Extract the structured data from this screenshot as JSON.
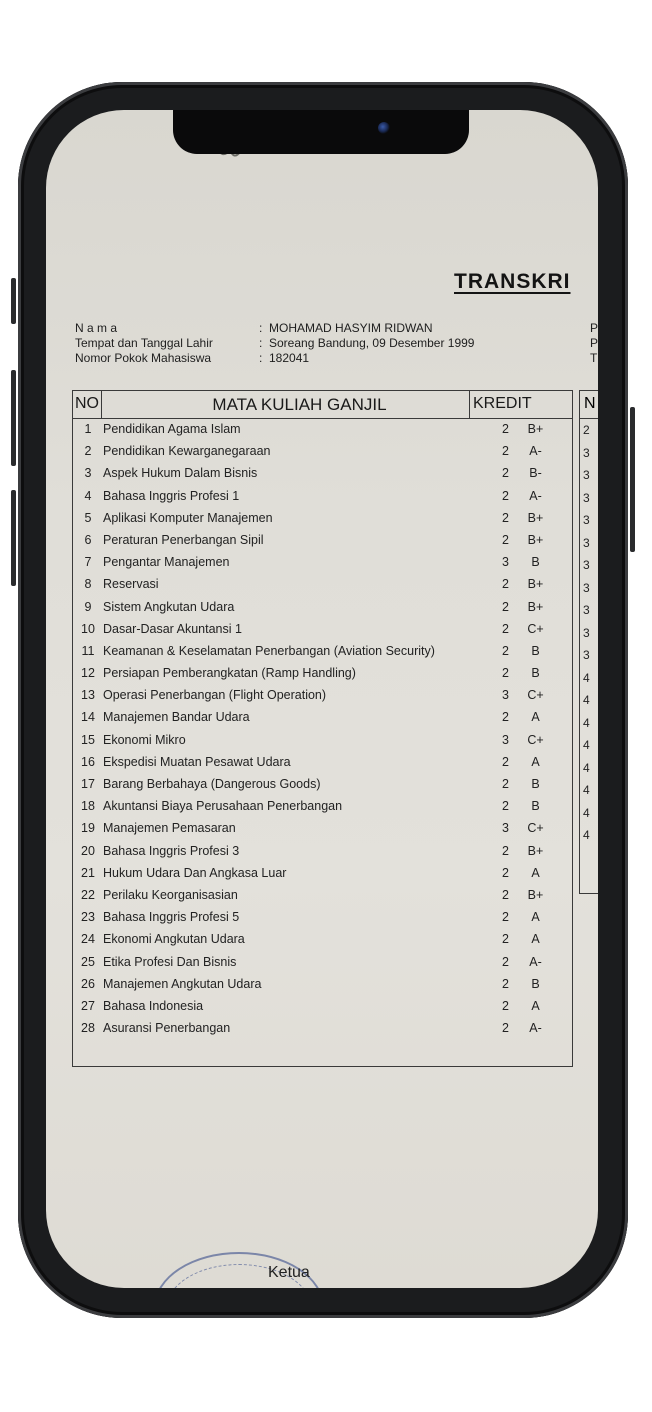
{
  "document": {
    "title": "TRANSKRI",
    "info": [
      {
        "label": "N a m a",
        "value": "MOHAMAD HASYIM RIDWAN"
      },
      {
        "label": "Tempat dan Tanggal Lahir",
        "value": "Soreang Bandung, 09 Desember 1999"
      },
      {
        "label": "Nomor Pokok Mahasiswa",
        "value": "182041"
      }
    ],
    "right_info": [
      "P",
      "P",
      "T"
    ],
    "table": {
      "headers": {
        "no": "NO",
        "course": "MATA KULIAH GANJIL",
        "credit": "KREDIT"
      },
      "rows": [
        {
          "no": "1",
          "course": "Pendidikan Agama Islam",
          "credit": "2",
          "grade": "B+"
        },
        {
          "no": "2",
          "course": "Pendidikan Kewarganegaraan",
          "credit": "2",
          "grade": "A-"
        },
        {
          "no": "3",
          "course": "Aspek Hukum Dalam Bisnis",
          "credit": "2",
          "grade": "B-"
        },
        {
          "no": "4",
          "course": "Bahasa Inggris Profesi 1",
          "credit": "2",
          "grade": "A-"
        },
        {
          "no": "5",
          "course": "Aplikasi Komputer Manajemen",
          "credit": "2",
          "grade": "B+"
        },
        {
          "no": "6",
          "course": "Peraturan Penerbangan Sipil",
          "credit": "2",
          "grade": "B+"
        },
        {
          "no": "7",
          "course": "Pengantar Manajemen",
          "credit": "3",
          "grade": "B"
        },
        {
          "no": "8",
          "course": "Reservasi",
          "credit": "2",
          "grade": "B+"
        },
        {
          "no": "9",
          "course": "Sistem Angkutan Udara",
          "credit": "2",
          "grade": "B+"
        },
        {
          "no": "10",
          "course": "Dasar-Dasar Akuntansi 1",
          "credit": "2",
          "grade": "C+"
        },
        {
          "no": "11",
          "course": "Keamanan & Keselamatan Penerbangan (Aviation Security)",
          "credit": "2",
          "grade": "B"
        },
        {
          "no": "12",
          "course": "Persiapan Pemberangkatan (Ramp Handling)",
          "credit": "2",
          "grade": "B"
        },
        {
          "no": "13",
          "course": "Operasi Penerbangan (Flight Operation)",
          "credit": "3",
          "grade": "C+"
        },
        {
          "no": "14",
          "course": "Manajemen Bandar Udara",
          "credit": "2",
          "grade": "A"
        },
        {
          "no": "15",
          "course": "Ekonomi Mikro",
          "credit": "3",
          "grade": "C+"
        },
        {
          "no": "16",
          "course": "Ekspedisi Muatan Pesawat Udara",
          "credit": "2",
          "grade": "A"
        },
        {
          "no": "17",
          "course": "Barang Berbahaya (Dangerous Goods)",
          "credit": "2",
          "grade": "B"
        },
        {
          "no": "18",
          "course": "Akuntansi Biaya Perusahaan Penerbangan",
          "credit": "2",
          "grade": "B"
        },
        {
          "no": "19",
          "course": "Manajemen Pemasaran",
          "credit": "3",
          "grade": "C+"
        },
        {
          "no": "20",
          "course": "Bahasa Inggris Profesi 3",
          "credit": "2",
          "grade": "B+"
        },
        {
          "no": "21",
          "course": "Hukum Udara Dan Angkasa Luar",
          "credit": "2",
          "grade": "A"
        },
        {
          "no": "22",
          "course": "Perilaku Keorganisasian",
          "credit": "2",
          "grade": "B+"
        },
        {
          "no": "23",
          "course": "Bahasa Inggris Profesi 5",
          "credit": "2",
          "grade": "A"
        },
        {
          "no": "24",
          "course": "Ekonomi Angkutan Udara",
          "credit": "2",
          "grade": "A"
        },
        {
          "no": "25",
          "course": "Etika Profesi Dan Bisnis",
          "credit": "2",
          "grade": "A-"
        },
        {
          "no": "26",
          "course": "Manajemen Angkutan Udara",
          "credit": "2",
          "grade": "B"
        },
        {
          "no": "27",
          "course": "Bahasa Indonesia",
          "credit": "2",
          "grade": "A"
        },
        {
          "no": "28",
          "course": "Asuransi Penerbangan",
          "credit": "2",
          "grade": "A-"
        }
      ]
    },
    "table2": {
      "header": "N",
      "cells": [
        "2",
        "3",
        "3",
        "3",
        "3",
        "3",
        "3",
        "3",
        "3",
        "3",
        "3",
        "4",
        "4",
        "4",
        "4",
        "4",
        "4",
        "4",
        "4"
      ]
    },
    "signature_label": "Ketua"
  }
}
